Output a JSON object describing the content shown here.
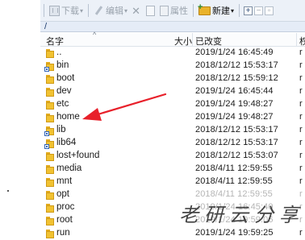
{
  "toolbar": {
    "download_label": "下载",
    "edit_label": "编辑",
    "properties_label": "属性",
    "new_label": "新建",
    "expand_glyph": "+",
    "collapse_glyph": "−",
    "restore_glyph": "▫"
  },
  "path": "/",
  "columns": {
    "name": "名字",
    "size": "大小",
    "modified": "已改变",
    "extra": "权"
  },
  "files": [
    {
      "name": "..",
      "date": "2019/1/24 16:45:49",
      "extra": "r",
      "link": false
    },
    {
      "name": "bin",
      "date": "2018/12/12 15:53:17",
      "extra": "r",
      "link": true
    },
    {
      "name": "boot",
      "date": "2018/12/12 15:59:12",
      "extra": "r",
      "link": false
    },
    {
      "name": "dev",
      "date": "2019/1/24 16:45:44",
      "extra": "r",
      "link": false
    },
    {
      "name": "etc",
      "date": "2019/1/24 19:48:27",
      "extra": "r",
      "link": false
    },
    {
      "name": "home",
      "date": "2019/1/24 19:48:27",
      "extra": "r",
      "link": false
    },
    {
      "name": "lib",
      "date": "2018/12/12 15:53:17",
      "extra": "r",
      "link": true
    },
    {
      "name": "lib64",
      "date": "2018/12/12 15:53:17",
      "extra": "r",
      "link": true
    },
    {
      "name": "lost+found",
      "date": "2018/12/12 15:53:07",
      "extra": "r",
      "link": false
    },
    {
      "name": "media",
      "date": "2018/4/11 12:59:55",
      "extra": "r",
      "link": false
    },
    {
      "name": "mnt",
      "date": "2018/4/11 12:59:55",
      "extra": "r",
      "link": false
    },
    {
      "name": "opt",
      "date": "2018/4/11 12:59:55",
      "extra": "r",
      "link": false,
      "faded": true
    },
    {
      "name": "proc",
      "date": "2019/1/24 16:45:40",
      "extra": "r",
      "link": false,
      "faded": true
    },
    {
      "name": "root",
      "date": "2019/1/24 19:59:06",
      "extra": "r",
      "link": false,
      "faded": true
    },
    {
      "name": "run",
      "date": "2019/1/24 19:59:25",
      "extra": "r",
      "link": false
    }
  ],
  "watermark": "老研云分享",
  "colors": {
    "folder": "#f1c232",
    "arrow": "#e8202a",
    "toolbar_bg": "#ecf1f8",
    "pathbar_bg": "#e5ecf7"
  }
}
